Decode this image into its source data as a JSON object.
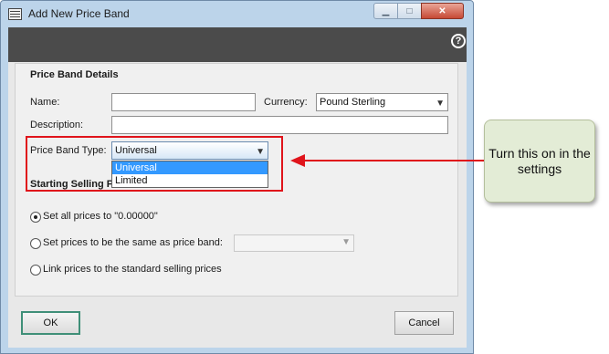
{
  "window": {
    "title": "Add New Price Band",
    "controls": [
      "minimize",
      "maximize",
      "close"
    ]
  },
  "help_label": "?",
  "section_details": "Price Band Details",
  "fields": {
    "name_label": "Name:",
    "name_value": "",
    "currency_label": "Currency:",
    "currency_value": "Pound Sterling",
    "description_label": "Description:",
    "description_value": "",
    "price_band_type_label": "Price Band Type:",
    "price_band_type_value": "Universal"
  },
  "dropdown_options": [
    "Universal",
    "Limited"
  ],
  "section_starting": "Starting Selling P",
  "radios": [
    {
      "label": "Set all prices to \"0.00000\"",
      "selected": true
    },
    {
      "label": "Set prices to be the same as price band:",
      "selected": false
    },
    {
      "label": "Link prices to the standard selling prices",
      "selected": false
    }
  ],
  "price_band_select_value": "",
  "buttons": {
    "ok": "OK",
    "cancel": "Cancel"
  },
  "callout": {
    "text": "Turn this on in the settings"
  },
  "colors": {
    "highlight": "#e0141b",
    "selection": "#3399ff",
    "ok_border": "#3f8f78"
  }
}
